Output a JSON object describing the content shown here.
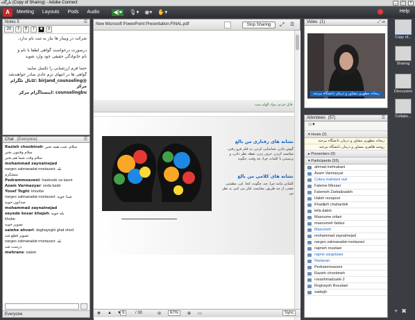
{
  "window": {
    "title": "تارگاه (Copy of Sharing) - Adobe Connect"
  },
  "menu": {
    "items": [
      "Meeting",
      "Layouts",
      "Pods",
      "Audio"
    ],
    "help": "Help"
  },
  "notes": {
    "title": "Notes 5",
    "font_size": "20",
    "lines": [
      "شرکت در وبینار ها نیاز به ثبت نام ندارد.",
      "درصورت درخواست گواهی لطفا با نام و",
      "نام خانوادگی حقیقی خود وارد شوید",
      "حتما فرم ارزشیابی را تکمیل نمایید",
      "گواهی ها در انتهای ترم عادی صادر خواهندشد",
      "@birjand_counseling :کانال تلگرام مرکز",
      "counselingbu :اینستاگرام مرکز"
    ]
  },
  "chat": {
    "title": "Chat",
    "audience": "(Everyone)",
    "tab": "Everyone",
    "messages": [
      {
        "name": "Razieh choobineh",
        "text": "سلام، شب همه بخیر"
      },
      {
        "name": "",
        "text": "سلام وقتتون بخیر"
      },
      {
        "name": "",
        "text": "سلام وقت شما هم بخیر"
      },
      {
        "name": "mohammad zaynalnejad",
        "text": ""
      },
      {
        "name": "",
        "text": "narges zalmaeadat mortazavi: بله"
      },
      {
        "name": "",
        "text": "متشکرم"
      },
      {
        "name": "Pedrammoaveni",
        "text": "hastesde va tasvir"
      },
      {
        "name": "Azam Varmazyar",
        "text": "seda bade"
      },
      {
        "name": "Yosef Toghi",
        "text": "khoobe"
      },
      {
        "name": "",
        "text": "narges zalmaeadat mortazavi: صدا خوبه"
      },
      {
        "name": "",
        "text": "صداتون خوبه"
      },
      {
        "name": "mohammad zaynalnejad",
        "text": ""
      },
      {
        "name": "seyede kosar khajeh",
        "text": "بله خوبه"
      },
      {
        "name": "",
        "text": "khube"
      },
      {
        "name": "",
        "text": "تصویر خوبه"
      },
      {
        "name": "saiehe ahvari",
        "text": "daghayeghi ghat shod"
      },
      {
        "name": "",
        "text": "تصویر قطع شد"
      },
      {
        "name": "",
        "text": "narges zalmaeadat mortazavi: بله"
      },
      {
        "name": "",
        "text": "درست شد"
      },
      {
        "name": "mehrane",
        "text": "salam"
      }
    ]
  },
  "share": {
    "title": "New Microsoft PowerPoint Presentation.FINAL.pdf",
    "stop_label": "Stop Sharing",
    "banner": "فایل فردی مواد الهام ست",
    "heading1": "نشانه های رفتاری من بالغ",
    "text1": "گوش دادن، شناسایی کردن، به فکر فرو رفتن، مقایسه کردن، حرف زدن، نقطه نظر دادن، و پرسیدن با کلمات چرا، چه وقت، چگونه",
    "heading2": "نشانه های کلامی من بالغ",
    "text2": "کلماتی مانند چرا، چه، چگونه، کجا، کی، مطمئن، چقدر، از چه طریق، مقایسه، فکر می کنم، به نظر من",
    "page": "9",
    "total": "/ 30",
    "zoom": "67%",
    "sync": "Sync"
  },
  "video": {
    "title": "Video",
    "count": "(1)",
    "caption": "ریحانه مطهری مشاور و درمان دانشگاه بیرجند"
  },
  "attendees": {
    "title": "Attendees",
    "count": "(57)",
    "hosts_label": "Hosts (2)",
    "hosts": [
      "ریحانه مطهری مشاور و درمان دانشگاه بیرجند",
      "روحیه طاهری مشاور و درمان دانشگاه بیرجند"
    ],
    "presenters_label": "Presenters (0)",
    "participants_label": "Participants (55)",
    "participants": [
      "ahmad mehrabani",
      "Azam Varmazyar",
      "Cobra mahdavi rad",
      "Fateme Mirzaei",
      "Fatemeh Zarbalizadeh",
      "Haleh rezapoor",
      "Khadijeh chahardoli",
      "leila dabiri",
      "Masoume orfani",
      "masoumeh fadavi",
      "Masumeh",
      "mohammad zaynalnejad",
      "narges zalmaeadat mortazavi",
      "najmeh roustaei",
      "najme sargolzaie",
      "Nastaran",
      "Pedrammoaveni",
      "Razieh choobineh",
      "rosashmadzade 2",
      "Roghayeh Roustaei",
      "sadegh"
    ]
  },
  "sidebar": {
    "items": [
      "Copy of...",
      "Sharing",
      "Discussion",
      "Collabo..."
    ]
  }
}
